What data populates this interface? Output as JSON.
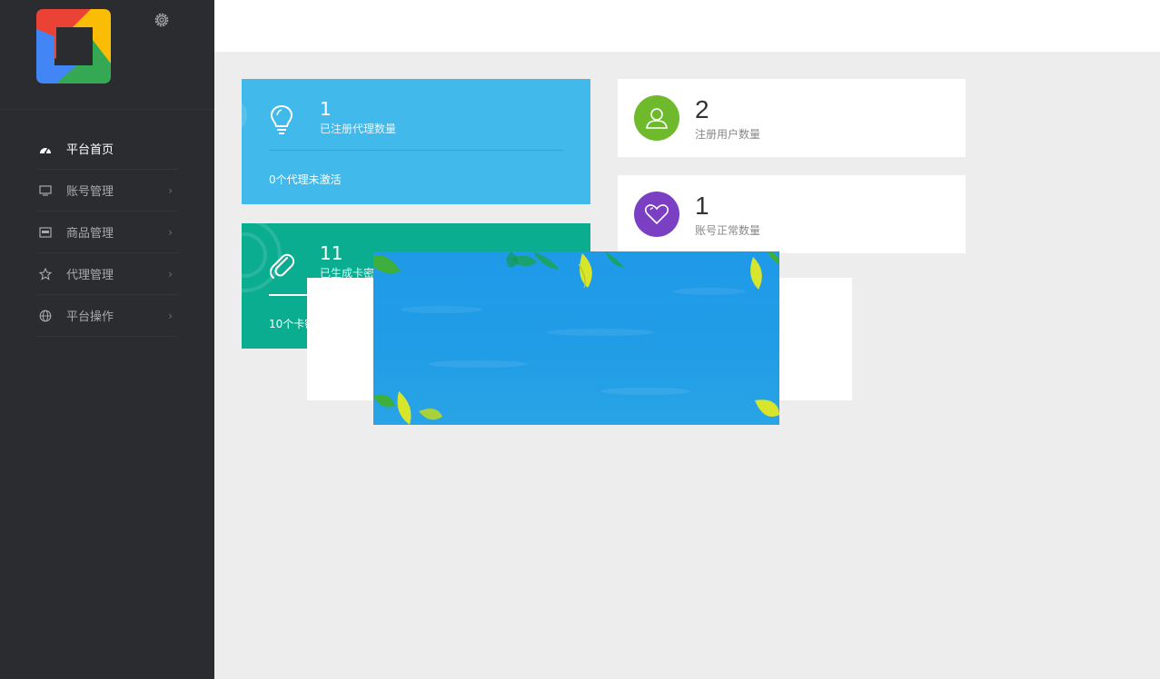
{
  "sidebar": {
    "items": [
      {
        "label": "平台首页",
        "icon": "dashboard-icon",
        "active": true
      },
      {
        "label": "账号管理",
        "icon": "monitor-icon"
      },
      {
        "label": "商品管理",
        "icon": "box-icon"
      },
      {
        "label": "代理管理",
        "icon": "star-icon"
      },
      {
        "label": "平台操作",
        "icon": "globe-icon"
      }
    ],
    "chevron": "›"
  },
  "cards": {
    "agents": {
      "number": "1",
      "label": "已注册代理数量",
      "footer": "0个代理未激活",
      "color": "#41b9ea"
    },
    "codes": {
      "number": "11",
      "label": "已生成卡密",
      "footer": "10个卡密",
      "color": "#0bad91"
    },
    "users": {
      "number": "2",
      "label": "注册用户数量",
      "color": "#6fba2c"
    },
    "accounts": {
      "number": "1",
      "label": "账号正常数量",
      "color": "#7b3fc4"
    }
  }
}
